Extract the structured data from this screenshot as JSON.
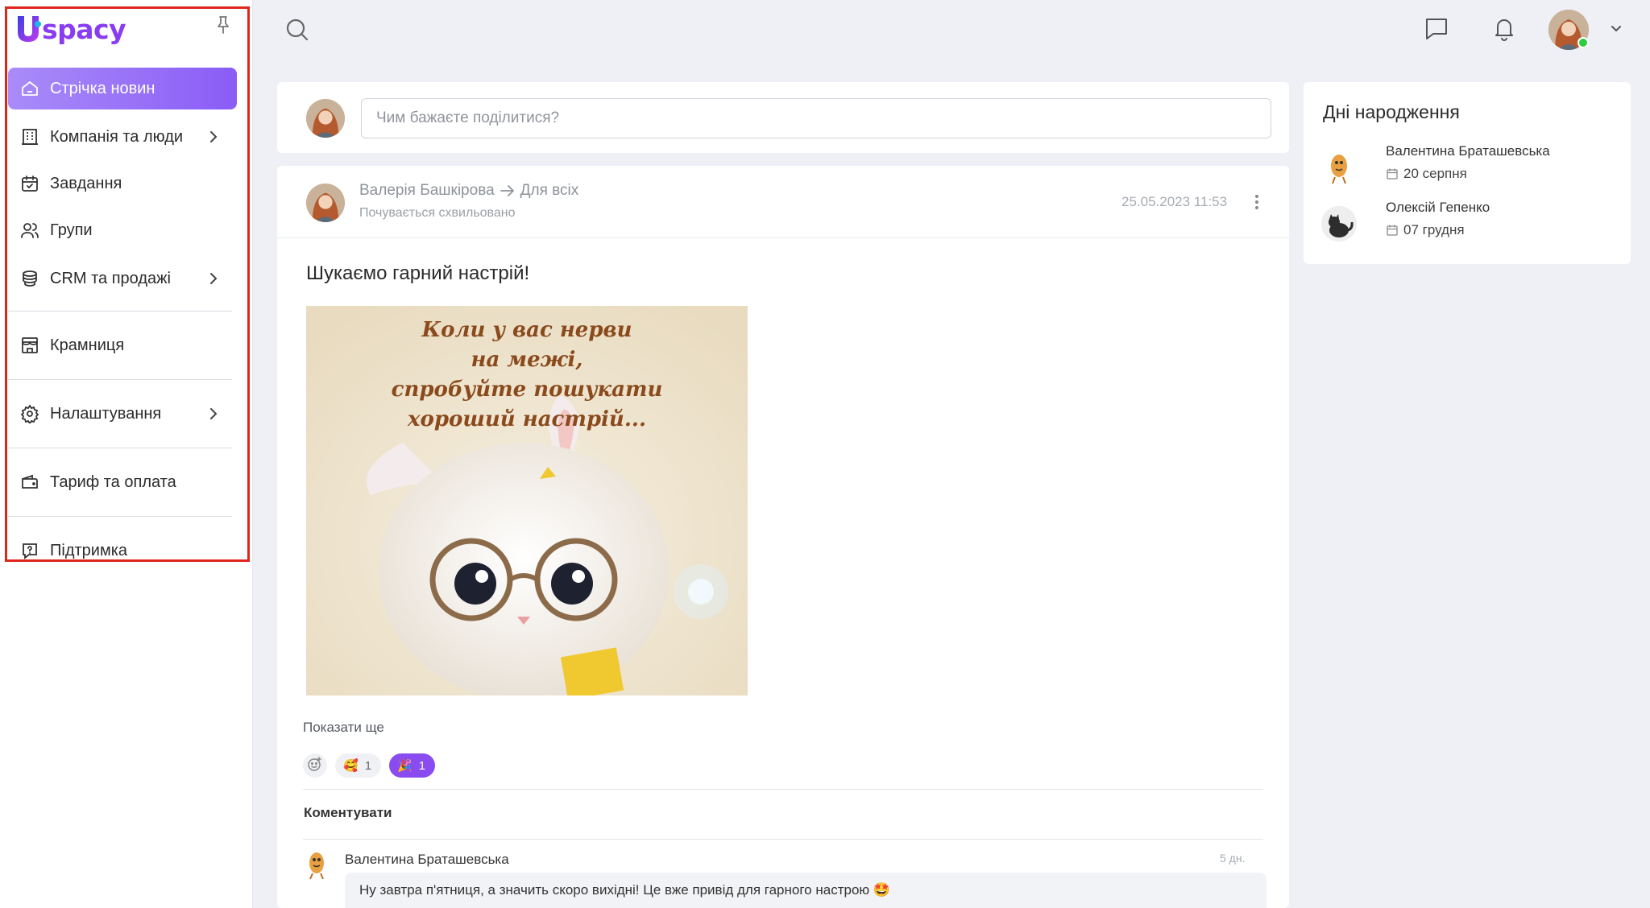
{
  "app": {
    "logo_text": "spacy",
    "brand_color": "#8a5cf6"
  },
  "sidebar": {
    "items": [
      {
        "label": "Стрічка новин",
        "icon": "home-icon",
        "active": true
      },
      {
        "label": "Компанія та люди",
        "icon": "building-icon",
        "has_children": true
      },
      {
        "label": "Завдання",
        "icon": "calendar-check-icon"
      },
      {
        "label": "Групи",
        "icon": "users-icon"
      },
      {
        "label": "CRM та продажі",
        "icon": "coins-icon",
        "has_children": true
      },
      {
        "label": "Крамниця",
        "icon": "store-icon"
      },
      {
        "label": "Налаштування",
        "icon": "gear-icon",
        "has_children": true
      },
      {
        "label": "Тариф та оплата",
        "icon": "wallet-icon"
      },
      {
        "label": "Підтримка",
        "icon": "help-icon"
      }
    ]
  },
  "composer": {
    "placeholder": "Чим бажаєте поділитися?"
  },
  "post": {
    "author": "Валерія Башкірова",
    "audience": "Для всіх",
    "mood": "Почувається схвильовано",
    "date": "25.05.2023 11:53",
    "title": "Шукаємо гарний настрій!",
    "image_text": [
      "Коли у вас нерви",
      "на межі,",
      "спробуйте пошукати",
      "хороший настрій..."
    ],
    "show_more": "Показати ще",
    "reactions": [
      {
        "emoji": "🥰",
        "count": "1",
        "active": false
      },
      {
        "emoji": "🎉",
        "count": "1",
        "active": true
      }
    ],
    "comment_label": "Коментувати",
    "comment": {
      "author": "Валентина Браташевська",
      "time": "5 дн.",
      "text": "Ну завтра п'ятниця, а значить скоро вихідні! Це вже привід для гарного настрою 🤩"
    }
  },
  "birthdays": {
    "title": "Дні народження",
    "people": [
      {
        "name": "Валентина Браташевська",
        "date": "20 серпня"
      },
      {
        "name": "Олексій Гепенко",
        "date": "07 грудня"
      }
    ]
  }
}
